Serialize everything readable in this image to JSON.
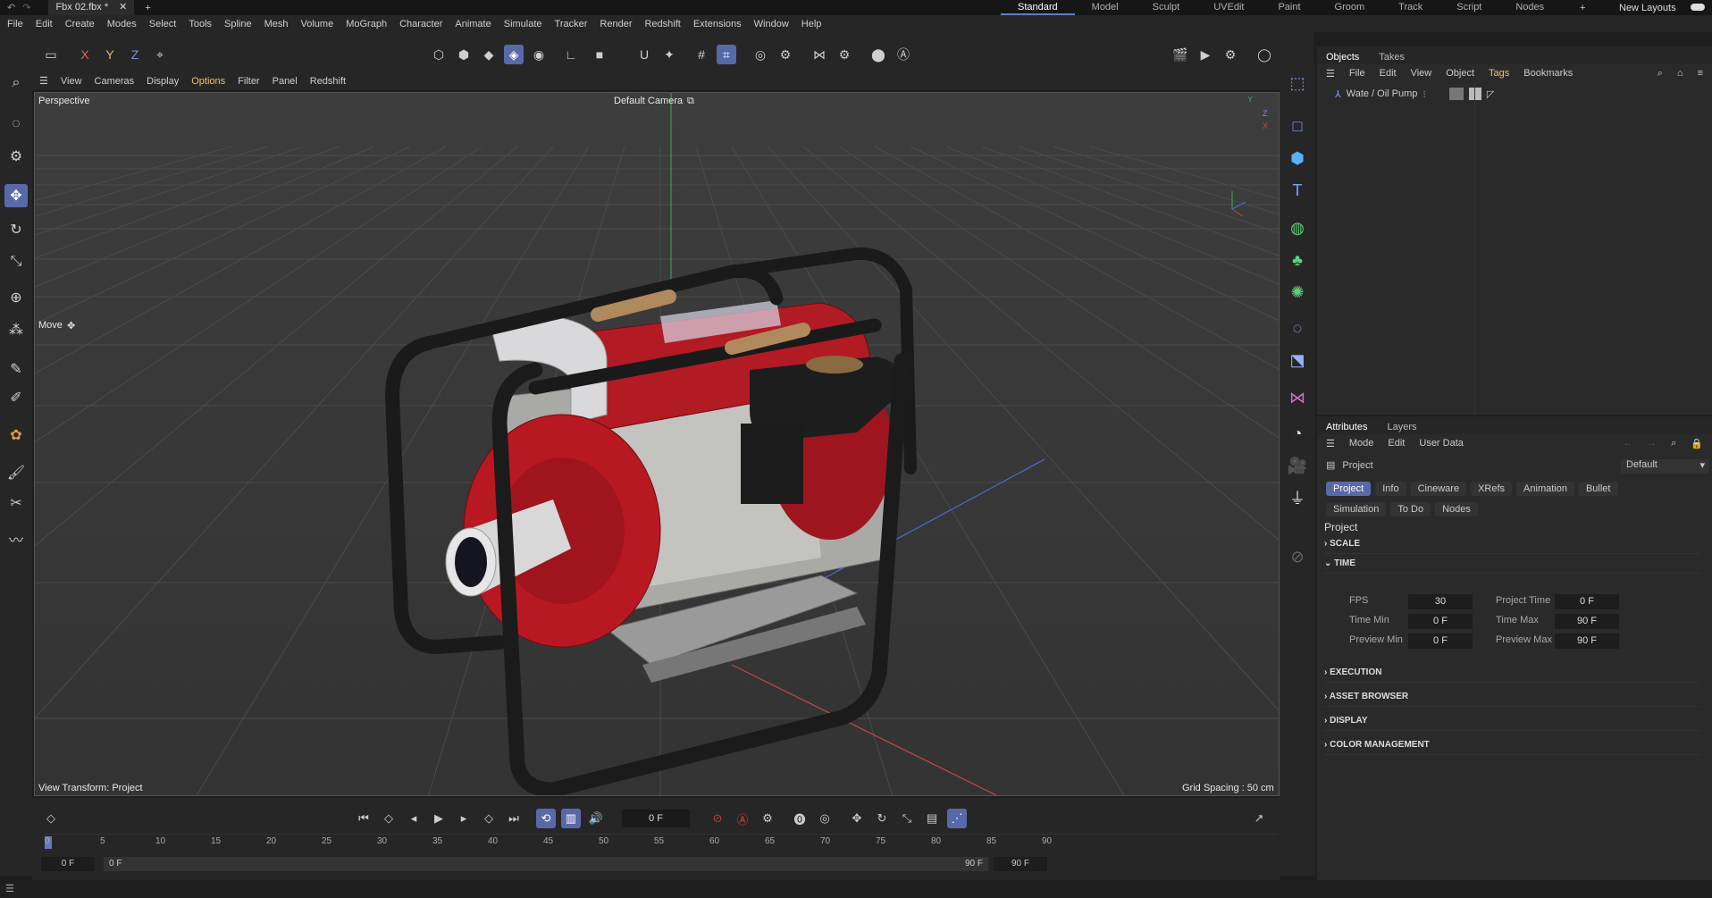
{
  "title_bar": {
    "document_tab": "Fbx 02.fbx *",
    "layouts": [
      "Standard",
      "Model",
      "Sculpt",
      "UVEdit",
      "Paint",
      "Groom",
      "Track",
      "Script",
      "Nodes"
    ],
    "active_layout": "Standard",
    "new_layouts_label": "New Layouts"
  },
  "menu": [
    "File",
    "Edit",
    "Create",
    "Modes",
    "Select",
    "Tools",
    "Spline",
    "Mesh",
    "Volume",
    "MoGraph",
    "Character",
    "Animate",
    "Simulate",
    "Tracker",
    "Render",
    "Redshift",
    "Extensions",
    "Window",
    "Help"
  ],
  "axis_buttons": [
    "X",
    "Y",
    "Z"
  ],
  "viewport_menu": [
    "View",
    "Cameras",
    "Display",
    "Options",
    "Filter",
    "Panel",
    "Redshift"
  ],
  "viewport": {
    "view_name": "Perspective",
    "camera_label": "Default Camera",
    "tool_label": "Move",
    "view_transform": "View Transform: Project",
    "grid_spacing": "Grid Spacing : 50 cm",
    "axis_y": "Y",
    "axis_z": "Z",
    "axis_x": "X"
  },
  "objects_panel": {
    "tabs": [
      "Objects",
      "Takes"
    ],
    "menu": [
      "File",
      "Edit",
      "View",
      "Object",
      "Tags",
      "Bookmarks"
    ],
    "object_name": "Wate / Oil Pump"
  },
  "attributes_panel": {
    "tabs": [
      "Attributes",
      "Layers"
    ],
    "menu": [
      "Mode",
      "Edit",
      "User Data"
    ],
    "object_type": "Project",
    "preset": "Default",
    "tag_buttons_row1": [
      "Project",
      "Info",
      "Cineware",
      "XRefs",
      "Animation",
      "Bullet"
    ],
    "tag_buttons_row2": [
      "Simulation",
      "To Do",
      "Nodes"
    ],
    "section_title": "Project",
    "sections": [
      "SCALE",
      "TIME",
      "EXECUTION",
      "ASSET BROWSER",
      "DISPLAY",
      "COLOR MANAGEMENT"
    ],
    "time_fields": {
      "fps_label": "FPS",
      "fps": "30",
      "project_time_label": "Project Time",
      "project_time": "0 F",
      "time_min_label": "Time Min",
      "time_min": "0 F",
      "time_max_label": "Time Max",
      "time_max": "90 F",
      "preview_min_label": "Preview Min",
      "preview_min": "0 F",
      "preview_max_label": "Preview Max",
      "preview_max": "90 F"
    }
  },
  "timeline": {
    "current_frame": "0 F",
    "ruler_ticks": [
      "0",
      "5",
      "10",
      "15",
      "20",
      "25",
      "30",
      "35",
      "40",
      "45",
      "50",
      "55",
      "60",
      "65",
      "70",
      "75",
      "80",
      "85",
      "90"
    ],
    "range_start": "0 F",
    "range_start2": "0 F",
    "range_end": "90 F",
    "range_end2": "90 F"
  }
}
